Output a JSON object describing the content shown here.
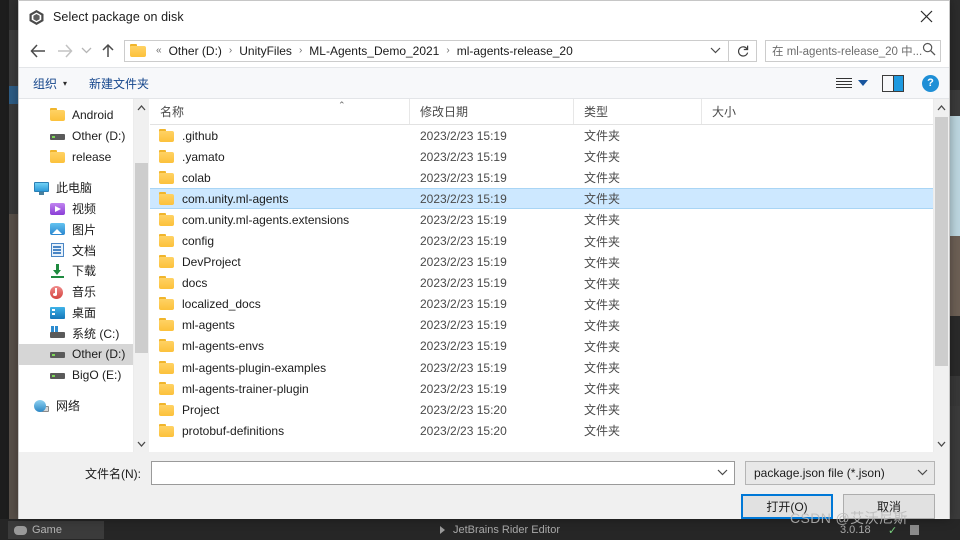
{
  "window": {
    "title": "Select package on disk",
    "app_icon": "unity-icon",
    "close_label": "✕"
  },
  "nav": {
    "back": "←",
    "forward": "→",
    "recent": "⌄",
    "up": "↑",
    "refresh": "↻",
    "breadcrumb_prefix": "«",
    "breadcrumbs": [
      "Other (D:)",
      "UnityFiles",
      "ML-Agents_Demo_2021",
      "ml-agents-release_20"
    ],
    "separator": "›",
    "dropdown_chevron": "⌄",
    "search_placeholder": "在 ml-agents-release_20 中...",
    "search_value": "",
    "search_icon": "search-icon"
  },
  "command_bar": {
    "organize_label": "组织",
    "organize_caret": "▾",
    "new_folder_label": "新建文件夹",
    "view_icon": "list-view-icon",
    "view_caret": "▾",
    "preview_pane_icon": "preview-pane-icon",
    "help_icon": "?"
  },
  "sidebar": {
    "items": [
      {
        "label": "Android",
        "icon": "folder-icon",
        "indent": "child",
        "selected": false
      },
      {
        "label": "Other (D:)",
        "icon": "drive-icon",
        "indent": "child",
        "selected": false
      },
      {
        "label": "release",
        "icon": "folder-icon",
        "indent": "child",
        "selected": false
      },
      {
        "label": "",
        "icon": "spacer",
        "indent": "spacer",
        "selected": false
      },
      {
        "label": "此电脑",
        "icon": "this-pc-icon",
        "indent": "root",
        "selected": false
      },
      {
        "label": "视频",
        "icon": "videos-icon",
        "indent": "child",
        "selected": false
      },
      {
        "label": "图片",
        "icon": "pictures-icon",
        "indent": "child",
        "selected": false
      },
      {
        "label": "文档",
        "icon": "documents-icon",
        "indent": "child",
        "selected": false
      },
      {
        "label": "下载",
        "icon": "downloads-icon",
        "indent": "child",
        "selected": false
      },
      {
        "label": "音乐",
        "icon": "music-icon",
        "indent": "child",
        "selected": false
      },
      {
        "label": "桌面",
        "icon": "desktop-icon",
        "indent": "child",
        "selected": false
      },
      {
        "label": "系统 (C:)",
        "icon": "system-drive-icon",
        "indent": "child",
        "selected": false
      },
      {
        "label": "Other (D:)",
        "icon": "drive-icon",
        "indent": "child",
        "selected": true
      },
      {
        "label": "BigO (E:)",
        "icon": "drive-icon",
        "indent": "child",
        "selected": false
      },
      {
        "label": "",
        "icon": "spacer",
        "indent": "spacer",
        "selected": false
      },
      {
        "label": "网络",
        "icon": "network-icon",
        "indent": "root",
        "selected": false
      }
    ],
    "scroll_up": "⌃",
    "scroll_down": "⌄"
  },
  "file_list": {
    "columns": [
      "名称",
      "修改日期",
      "类型",
      "大小"
    ],
    "sort_indicator": "⌃",
    "rows": [
      {
        "name": ".github",
        "date": "2023/2/23 15:19",
        "type": "文件夹",
        "size": "",
        "selected": false
      },
      {
        "name": ".yamato",
        "date": "2023/2/23 15:19",
        "type": "文件夹",
        "size": "",
        "selected": false
      },
      {
        "name": "colab",
        "date": "2023/2/23 15:19",
        "type": "文件夹",
        "size": "",
        "selected": false
      },
      {
        "name": "com.unity.ml-agents",
        "date": "2023/2/23 15:19",
        "type": "文件夹",
        "size": "",
        "selected": true
      },
      {
        "name": "com.unity.ml-agents.extensions",
        "date": "2023/2/23 15:19",
        "type": "文件夹",
        "size": "",
        "selected": false
      },
      {
        "name": "config",
        "date": "2023/2/23 15:19",
        "type": "文件夹",
        "size": "",
        "selected": false
      },
      {
        "name": "DevProject",
        "date": "2023/2/23 15:19",
        "type": "文件夹",
        "size": "",
        "selected": false
      },
      {
        "name": "docs",
        "date": "2023/2/23 15:19",
        "type": "文件夹",
        "size": "",
        "selected": false
      },
      {
        "name": "localized_docs",
        "date": "2023/2/23 15:19",
        "type": "文件夹",
        "size": "",
        "selected": false
      },
      {
        "name": "ml-agents",
        "date": "2023/2/23 15:19",
        "type": "文件夹",
        "size": "",
        "selected": false
      },
      {
        "name": "ml-agents-envs",
        "date": "2023/2/23 15:19",
        "type": "文件夹",
        "size": "",
        "selected": false
      },
      {
        "name": "ml-agents-plugin-examples",
        "date": "2023/2/23 15:19",
        "type": "文件夹",
        "size": "",
        "selected": false
      },
      {
        "name": "ml-agents-trainer-plugin",
        "date": "2023/2/23 15:19",
        "type": "文件夹",
        "size": "",
        "selected": false
      },
      {
        "name": "Project",
        "date": "2023/2/23 15:20",
        "type": "文件夹",
        "size": "",
        "selected": false
      },
      {
        "name": "protobuf-definitions",
        "date": "2023/2/23 15:20",
        "type": "文件夹",
        "size": "",
        "selected": false
      }
    ],
    "scroll_up": "⌃",
    "scroll_down": "⌄"
  },
  "footer": {
    "filename_label": "文件名(N):",
    "filename_value": "",
    "filename_chevron": "⌄",
    "filter_value": "package.json file (*.json)",
    "filter_chevron": "⌄",
    "open_button": "打开(O)",
    "cancel_button": "取消"
  },
  "backdrop": {
    "game_tab": "Game",
    "package_name": "JetBrains Rider Editor",
    "package_version": "3.0.18",
    "package_check": "✓"
  },
  "watermark": "CSDN @艾沃尼斯",
  "colors": {
    "accent_blue": "#0078d7",
    "selection_blue": "#cde8ff",
    "link_blue": "#15468c",
    "folder_yellow": "#fcc13b",
    "help_blue": "#1f8fd6"
  }
}
